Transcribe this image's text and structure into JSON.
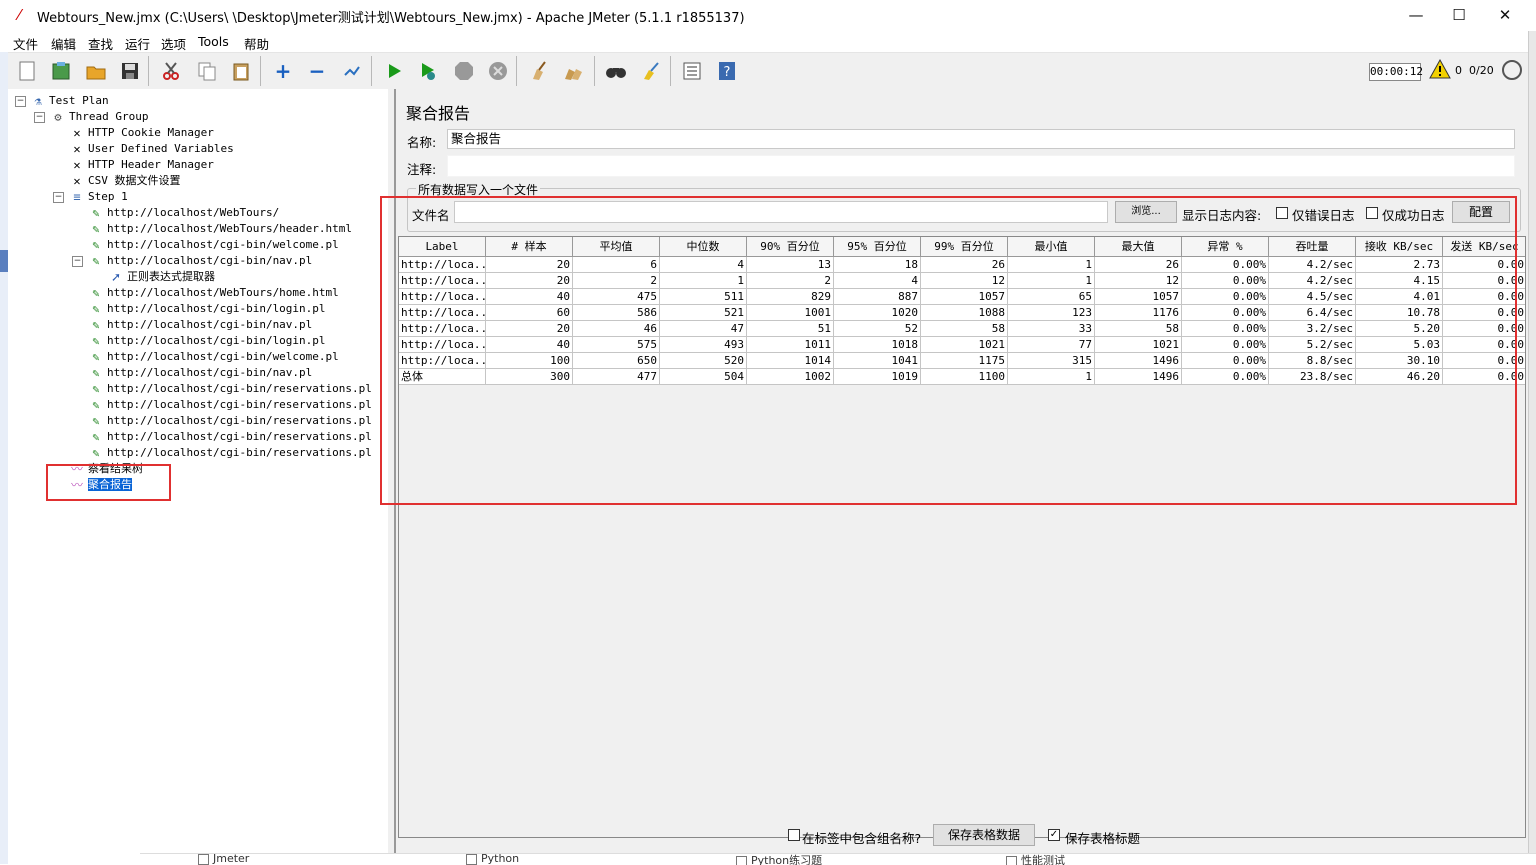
{
  "window": {
    "title": "Webtours_New.jmx (C:\\Users\\      \\Desktop\\Jmeter测试计划\\Webtours_New.jmx) - Apache JMeter (5.1.1 r1855137)",
    "minimize": "—",
    "maximize": "☐",
    "close": "✕"
  },
  "menu": [
    "文件",
    "编辑",
    "查找",
    "运行",
    "选项",
    "Tools",
    "帮助"
  ],
  "toolbar": {
    "timer": "00:00:12",
    "warning_count": "0",
    "threads": "0/20"
  },
  "tree": {
    "nodes": [
      {
        "label": "Test Plan",
        "icon": "flask-icon"
      },
      {
        "label": "Thread Group",
        "icon": "gear-icon"
      },
      {
        "label": "HTTP Cookie Manager",
        "icon": "tools-icon"
      },
      {
        "label": "User Defined Variables",
        "icon": "tools-icon"
      },
      {
        "label": "HTTP Header Manager",
        "icon": "tools-icon"
      },
      {
        "label": "CSV 数据文件设置",
        "icon": "tools-icon"
      },
      {
        "label": "Step 1",
        "icon": "controller-icon"
      },
      {
        "label": "http://localhost/WebTours/",
        "icon": "pen-icon"
      },
      {
        "label": "http://localhost/WebTours/header.html",
        "icon": "pen-icon"
      },
      {
        "label": "http://localhost/cgi-bin/welcome.pl",
        "icon": "pen-icon"
      },
      {
        "label": "http://localhost/cgi-bin/nav.pl",
        "icon": "pen-icon"
      },
      {
        "label": "正则表达式提取器",
        "icon": "arrow-icon"
      },
      {
        "label": "http://localhost/WebTours/home.html",
        "icon": "pen-icon"
      },
      {
        "label": "http://localhost/cgi-bin/login.pl",
        "icon": "pen-icon"
      },
      {
        "label": "http://localhost/cgi-bin/nav.pl",
        "icon": "pen-icon"
      },
      {
        "label": "http://localhost/cgi-bin/login.pl",
        "icon": "pen-icon"
      },
      {
        "label": "http://localhost/cgi-bin/welcome.pl",
        "icon": "pen-icon"
      },
      {
        "label": "http://localhost/cgi-bin/nav.pl",
        "icon": "pen-icon"
      },
      {
        "label": "http://localhost/cgi-bin/reservations.pl",
        "icon": "pen-icon"
      },
      {
        "label": "http://localhost/cgi-bin/reservations.pl",
        "icon": "pen-icon"
      },
      {
        "label": "http://localhost/cgi-bin/reservations.pl",
        "icon": "pen-icon"
      },
      {
        "label": "http://localhost/cgi-bin/reservations.pl",
        "icon": "pen-icon"
      },
      {
        "label": "http://localhost/cgi-bin/reservations.pl",
        "icon": "pen-icon"
      },
      {
        "label": "察看结果树",
        "icon": "chart-icon"
      },
      {
        "label": "聚合报告",
        "icon": "chart-icon"
      }
    ]
  },
  "panel": {
    "title": "聚合报告",
    "name_label": "名称:",
    "name_value": "聚合报告",
    "comment_label": "注释:",
    "comment_value": "",
    "fieldset_legend": "所有数据写入一个文件",
    "filename_label": "文件名",
    "filename_value": "",
    "browse_button": "浏览...",
    "log_label": "显示日志内容:",
    "errors_only": "仅错误日志",
    "success_only": "仅成功日志",
    "configure_button": "配置",
    "include_group": "在标签中包含组名称?",
    "save_data_button": "保存表格数据",
    "save_header": "保存表格标题"
  },
  "table": {
    "columns": [
      "Label",
      "# 样本",
      "平均值",
      "中位数",
      "90% 百分位",
      "95% 百分位",
      "99% 百分位",
      "最小值",
      "最大值",
      "异常 %",
      "吞吐量",
      "接收 KB/sec",
      "发送 KB/sec"
    ],
    "rows": [
      [
        "http://loca...",
        "20",
        "6",
        "4",
        "13",
        "18",
        "26",
        "1",
        "26",
        "0.00%",
        "4.2/sec",
        "2.73",
        "0.00"
      ],
      [
        "http://loca...",
        "20",
        "2",
        "1",
        "2",
        "4",
        "12",
        "1",
        "12",
        "0.00%",
        "4.2/sec",
        "4.15",
        "0.00"
      ],
      [
        "http://loca...",
        "40",
        "475",
        "511",
        "829",
        "887",
        "1057",
        "65",
        "1057",
        "0.00%",
        "4.5/sec",
        "4.01",
        "0.00"
      ],
      [
        "http://loca...",
        "60",
        "586",
        "521",
        "1001",
        "1020",
        "1088",
        "123",
        "1176",
        "0.00%",
        "6.4/sec",
        "10.78",
        "0.00"
      ],
      [
        "http://loca...",
        "20",
        "46",
        "47",
        "51",
        "52",
        "58",
        "33",
        "58",
        "0.00%",
        "3.2/sec",
        "5.20",
        "0.00"
      ],
      [
        "http://loca...",
        "40",
        "575",
        "493",
        "1011",
        "1018",
        "1021",
        "77",
        "1021",
        "0.00%",
        "5.2/sec",
        "5.03",
        "0.00"
      ],
      [
        "http://loca...",
        "100",
        "650",
        "520",
        "1014",
        "1041",
        "1175",
        "315",
        "1496",
        "0.00%",
        "8.8/sec",
        "30.10",
        "0.00"
      ],
      [
        "总体",
        "300",
        "477",
        "504",
        "1002",
        "1019",
        "1100",
        "1",
        "1496",
        "0.00%",
        "23.8/sec",
        "46.20",
        "0.00"
      ]
    ]
  },
  "taskbar": [
    "Jmeter",
    "Python",
    "Python练习题",
    "性能测试"
  ],
  "colors": {
    "highlight": "#e03030",
    "selection": "#0a64d6"
  }
}
